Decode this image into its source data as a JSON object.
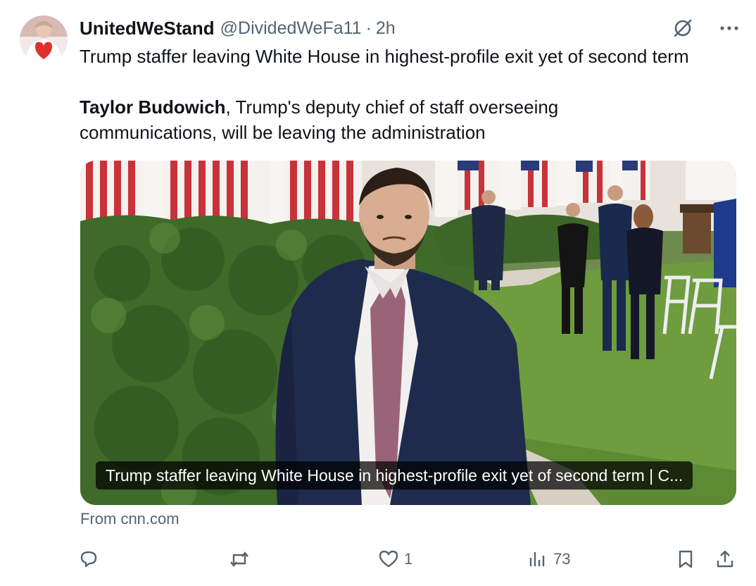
{
  "post": {
    "display_name": "UnitedWeStand",
    "handle": "@DividedWeFa11",
    "separator": "·",
    "time": "2h",
    "text_line1": "Trump staffer leaving White House in highest-profile exit yet of second term",
    "text_bold": "Taylor Budowich",
    "text_rest": ", Trump's deputy chief of staff overseeing communications, will be leaving the administration"
  },
  "card": {
    "caption": "Trump staffer leaving White House in highest-profile exit yet of second term | C...",
    "source": "From cnn.com"
  },
  "actions": {
    "reply_count": "",
    "repost_count": "",
    "like_count": "1",
    "views_count": "73"
  },
  "icons": {
    "grok": "grok-icon",
    "more": "more-icon",
    "reply": "reply-icon",
    "repost": "repost-icon",
    "like": "heart-icon",
    "views": "views-icon",
    "bookmark": "bookmark-icon",
    "share": "share-icon"
  },
  "colors": {
    "text_primary": "#0f1419",
    "text_secondary": "#536471"
  }
}
